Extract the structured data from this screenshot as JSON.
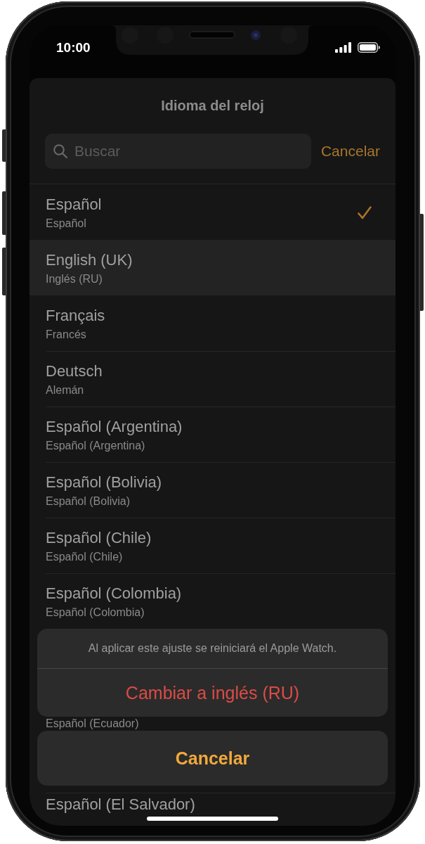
{
  "status_bar": {
    "time": "10:00"
  },
  "sheet": {
    "title": "Idioma del reloj",
    "search": {
      "placeholder": "Buscar"
    },
    "cancel": "Cancelar"
  },
  "list": {
    "rows": [
      {
        "name": "Español",
        "translation": "Español",
        "checked": true,
        "selected": false
      },
      {
        "name": "English (UK)",
        "translation": "Inglés (RU)",
        "checked": false,
        "selected": true
      },
      {
        "name": "Français",
        "translation": "Francés",
        "checked": false,
        "selected": false
      },
      {
        "name": "Deutsch",
        "translation": "Alemán",
        "checked": false,
        "selected": false
      },
      {
        "name": "Español (Argentina)",
        "translation": "Español (Argentina)",
        "checked": false,
        "selected": false
      },
      {
        "name": "Español (Bolivia)",
        "translation": "Español (Bolivia)",
        "checked": false,
        "selected": false
      },
      {
        "name": "Español (Chile)",
        "translation": "Español (Chile)",
        "checked": false,
        "selected": false
      },
      {
        "name": "Español (Colombia)",
        "translation": "Español (Colombia)",
        "checked": false,
        "selected": false
      }
    ]
  },
  "action_sheet": {
    "message": "Al aplicar este ajuste se reiniciará el Apple Watch.",
    "action": "Cambiar a inglés (RU)",
    "cancel": "Cancelar"
  },
  "rows_behind_sheet": [
    {
      "translation": "Español (Ecuador)"
    },
    {
      "name": "Español (El Salvador)"
    }
  ]
}
